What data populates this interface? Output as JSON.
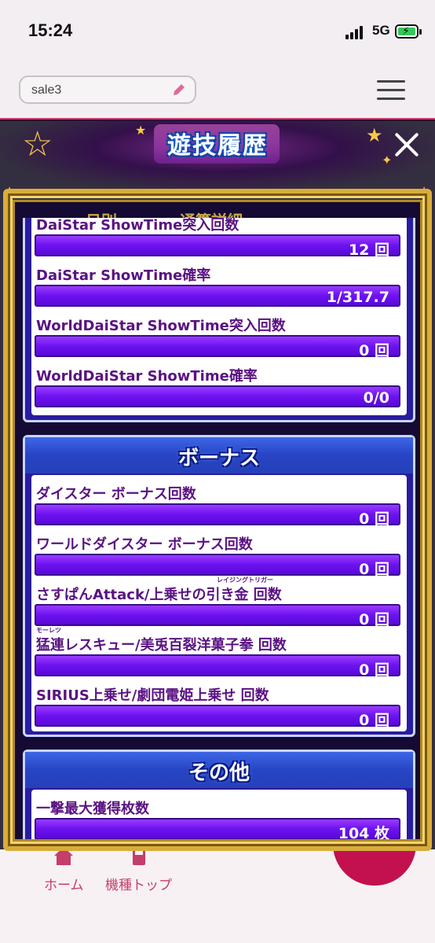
{
  "status_bar": {
    "time": "15:24",
    "network": "5G"
  },
  "header": {
    "search_value": "sale3"
  },
  "overlay": {
    "title": "遊技履歴",
    "behind_tabs": "日別　　　　通算詳細",
    "sections": [
      {
        "id": "top",
        "rows": [
          {
            "label": "DaiStar ShowTime突入回数",
            "value": "12 回"
          },
          {
            "label": "DaiStar ShowTime確率",
            "value": "1/317.7"
          },
          {
            "label": "WorldDaiStar ShowTime突入回数",
            "value": "0 回"
          },
          {
            "label": "WorldDaiStar ShowTime確率",
            "value": "0/0"
          }
        ]
      },
      {
        "id": "bonus",
        "title": "ボーナス",
        "rows": [
          {
            "label": "ダイスター ボーナス回数",
            "value": "0 回"
          },
          {
            "label": "ワールドダイスター ボーナス回数",
            "value": "0 回"
          },
          {
            "label": "さすぱんAttack/上乗せの引き金 回数",
            "value": "0 回",
            "ruby": "レイジングトリガー"
          },
          {
            "label": "猛連レスキュー/美兎百裂洋菓子拳 回数",
            "value": "0 回",
            "ruby": "モーレツ"
          },
          {
            "label": "SIRIUS上乗せ/劇団電姫上乗せ 回数",
            "value": "0 回"
          }
        ]
      },
      {
        "id": "other",
        "title": "その他",
        "rows": [
          {
            "label": "一撃最大獲得枚数",
            "value": "104 枚"
          }
        ]
      }
    ]
  },
  "bottom_nav": {
    "home": "ホーム",
    "machine_top": "機種トップ"
  },
  "colors": {
    "accent": "#c43d6b",
    "bar": "#6d12f0",
    "label": "#5a1282",
    "frame": "#d9ad3a"
  }
}
